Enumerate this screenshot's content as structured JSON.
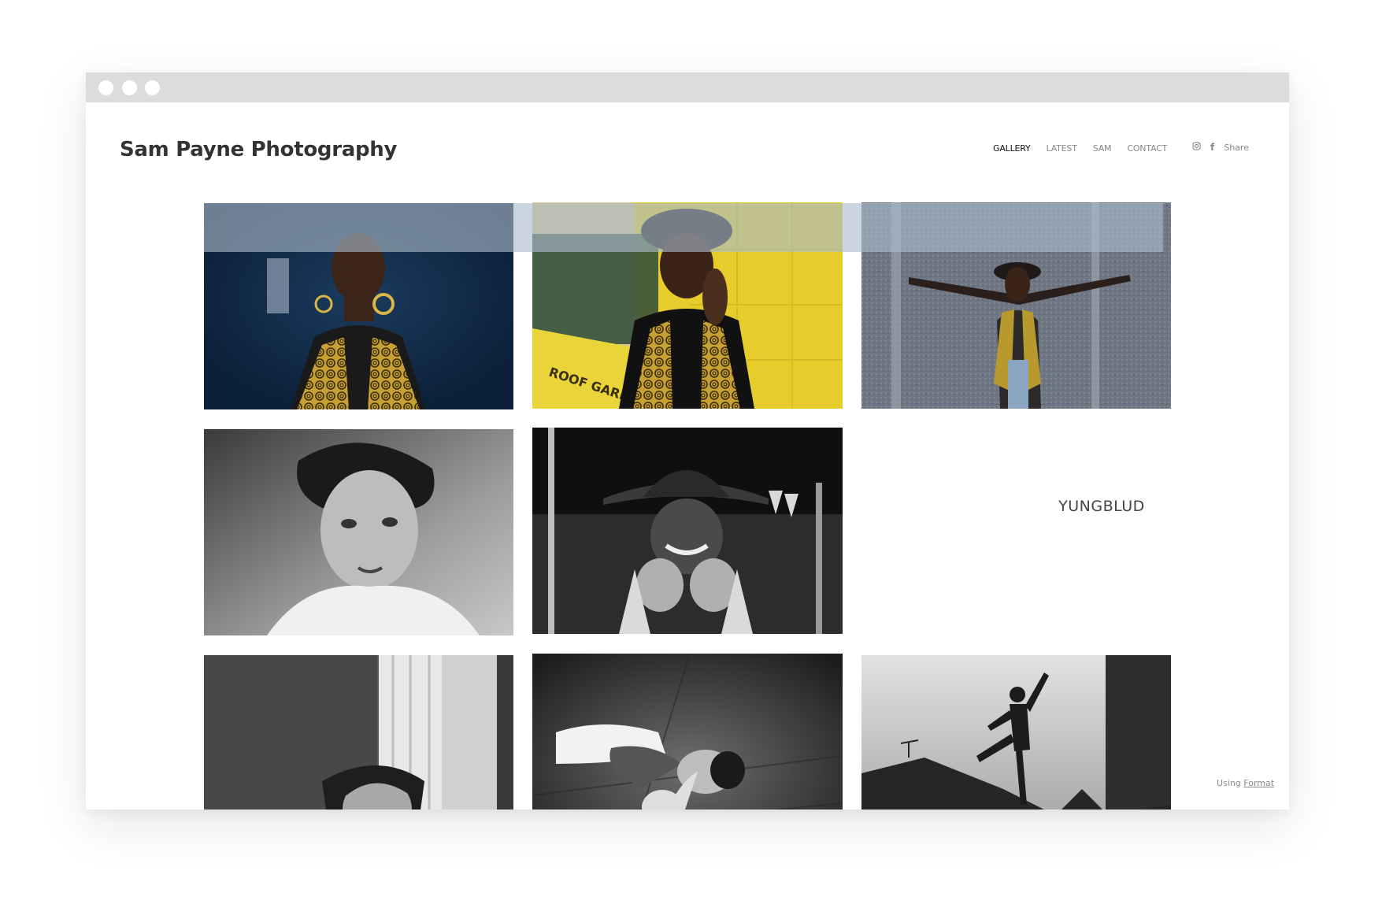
{
  "site": {
    "title": "Sam Payne Photography"
  },
  "nav": {
    "items": [
      "GALLERY",
      "LATEST",
      "SAM",
      "CONTACT"
    ],
    "active": "GALLERY"
  },
  "social": {
    "instagram_icon": "instagram-icon",
    "facebook_glyph": "f",
    "share_label": "Share"
  },
  "gallery": {
    "text_tile_label": "YUNGBLUD",
    "photos": [
      {
        "id": "woman-dark-blue-portrait",
        "tone": "color"
      },
      {
        "id": "woman-yellow-wall-hat",
        "tone": "color"
      },
      {
        "id": "woman-arms-outstretched-wall",
        "tone": "color"
      },
      {
        "id": "young-man-portrait-bw",
        "tone": "bw"
      },
      {
        "id": "woman-hat-laughing-bw",
        "tone": "bw"
      },
      {
        "id": "young-man-window-bw",
        "tone": "bw"
      },
      {
        "id": "man-lying-floor-bw",
        "tone": "bw"
      },
      {
        "id": "silhouette-rooftop-bw",
        "tone": "bw"
      }
    ]
  },
  "footer": {
    "using_label": "Using",
    "format_link": "Format"
  },
  "colors": {
    "header_overlay": "#abbbcc",
    "title_text": "#333333",
    "nav_active": "#111111",
    "nav_inactive": "#888888",
    "navy": "#0e2a48",
    "mustard": "#c9a636",
    "yellow": "#e6cc2a"
  }
}
